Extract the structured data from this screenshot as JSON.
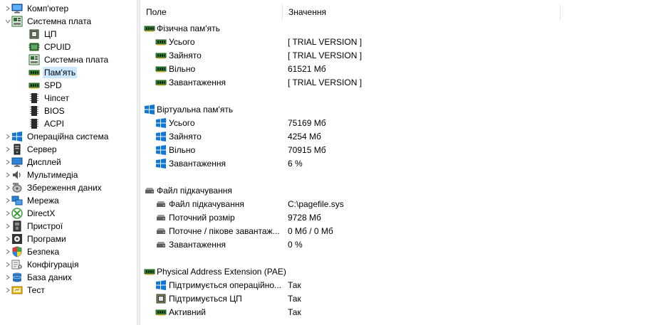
{
  "tree": [
    {
      "id": "computer",
      "label": "Комп'ютер",
      "icon": "computer-icon",
      "arrow": "collapsed",
      "level": 0
    },
    {
      "id": "motherboard",
      "label": "Системна плата",
      "icon": "motherboard-icon",
      "arrow": "expanded",
      "level": 0
    },
    {
      "id": "cpu",
      "label": "ЦП",
      "icon": "cpu-icon",
      "arrow": "none",
      "level": 1
    },
    {
      "id": "cpuid",
      "label": "CPUID",
      "icon": "cpuid-icon",
      "arrow": "none",
      "level": 1
    },
    {
      "id": "mb",
      "label": "Системна плата",
      "icon": "motherboard-icon",
      "arrow": "none",
      "level": 1
    },
    {
      "id": "memory",
      "label": "Пам'ять",
      "icon": "memory-icon",
      "arrow": "none",
      "level": 1,
      "selected": true
    },
    {
      "id": "spd",
      "label": "SPD",
      "icon": "memory-icon",
      "arrow": "none",
      "level": 1
    },
    {
      "id": "chipset",
      "label": "Чіпсет",
      "icon": "chip-icon",
      "arrow": "none",
      "level": 1
    },
    {
      "id": "bios",
      "label": "BIOS",
      "icon": "chip-icon",
      "arrow": "none",
      "level": 1
    },
    {
      "id": "acpi",
      "label": "ACPI",
      "icon": "chip-icon",
      "arrow": "none",
      "level": 1
    },
    {
      "id": "os",
      "label": "Операційна система",
      "icon": "windows-icon",
      "arrow": "collapsed",
      "level": 0
    },
    {
      "id": "server",
      "label": "Сервер",
      "icon": "server-icon",
      "arrow": "collapsed",
      "level": 0
    },
    {
      "id": "display",
      "label": "Дисплей",
      "icon": "monitor-icon",
      "arrow": "collapsed",
      "level": 0
    },
    {
      "id": "multimedia",
      "label": "Мультимедіа",
      "icon": "speaker-icon",
      "arrow": "collapsed",
      "level": 0
    },
    {
      "id": "storage",
      "label": "Збереження даних",
      "icon": "storage-icon",
      "arrow": "collapsed",
      "level": 0
    },
    {
      "id": "network",
      "label": "Мережа",
      "icon": "network-icon",
      "arrow": "collapsed",
      "level": 0
    },
    {
      "id": "directx",
      "label": "DirectX",
      "icon": "directx-icon",
      "arrow": "collapsed",
      "level": 0
    },
    {
      "id": "devices",
      "label": "Пристрої",
      "icon": "devices-icon",
      "arrow": "collapsed",
      "level": 0
    },
    {
      "id": "programs",
      "label": "Програми",
      "icon": "programs-icon",
      "arrow": "collapsed",
      "level": 0
    },
    {
      "id": "security",
      "label": "Безпека",
      "icon": "shield-icon",
      "arrow": "collapsed",
      "level": 0
    },
    {
      "id": "config",
      "label": "Конфігурація",
      "icon": "config-icon",
      "arrow": "collapsed",
      "level": 0
    },
    {
      "id": "database",
      "label": "База даних",
      "icon": "database-icon",
      "arrow": "collapsed",
      "level": 0
    },
    {
      "id": "test",
      "label": "Тест",
      "icon": "test-icon",
      "arrow": "collapsed",
      "level": 0
    }
  ],
  "columns": {
    "field": "Поле",
    "value": "Значення"
  },
  "groups": [
    {
      "title": "Фізична пам'ять",
      "icon": "memory-icon",
      "items": [
        {
          "field": "Усього",
          "value": "[ TRIAL VERSION ]",
          "icon": "memory-icon"
        },
        {
          "field": "Зайнято",
          "value": "[ TRIAL VERSION ]",
          "icon": "memory-icon"
        },
        {
          "field": "Вільно",
          "value": "61521 Мб",
          "icon": "memory-icon"
        },
        {
          "field": "Завантаження",
          "value": "[ TRIAL VERSION ]",
          "icon": "memory-icon"
        }
      ]
    },
    {
      "title": "Віртуальна пам'ять",
      "icon": "windows-icon",
      "items": [
        {
          "field": "Усього",
          "value": "75169 Мб",
          "icon": "windows-icon"
        },
        {
          "field": "Зайнято",
          "value": "4254 Мб",
          "icon": "windows-icon"
        },
        {
          "field": "Вільно",
          "value": "70915 Мб",
          "icon": "windows-icon"
        },
        {
          "field": "Завантаження",
          "value": "6 %",
          "icon": "windows-icon"
        }
      ]
    },
    {
      "title": "Файл підкачування",
      "icon": "drive-icon",
      "items": [
        {
          "field": "Файл підкачування",
          "value": "C:\\pagefile.sys",
          "icon": "drive-icon"
        },
        {
          "field": "Поточний розмір",
          "value": "9728 Мб",
          "icon": "drive-icon"
        },
        {
          "field": "Поточне / пікове завантаж...",
          "value": "0 Мб / 0 Мб",
          "icon": "drive-icon"
        },
        {
          "field": "Завантаження",
          "value": "0 %",
          "icon": "drive-icon"
        }
      ]
    },
    {
      "title": "Physical Address Extension (PAE)",
      "icon": "memory-icon",
      "items": [
        {
          "field": "Підтримується операційно...",
          "value": "Так",
          "icon": "windows-icon"
        },
        {
          "field": "Підтримується ЦП",
          "value": "Так",
          "icon": "cpu-icon"
        },
        {
          "field": "Активний",
          "value": "Так",
          "icon": "memory-icon"
        }
      ]
    }
  ]
}
